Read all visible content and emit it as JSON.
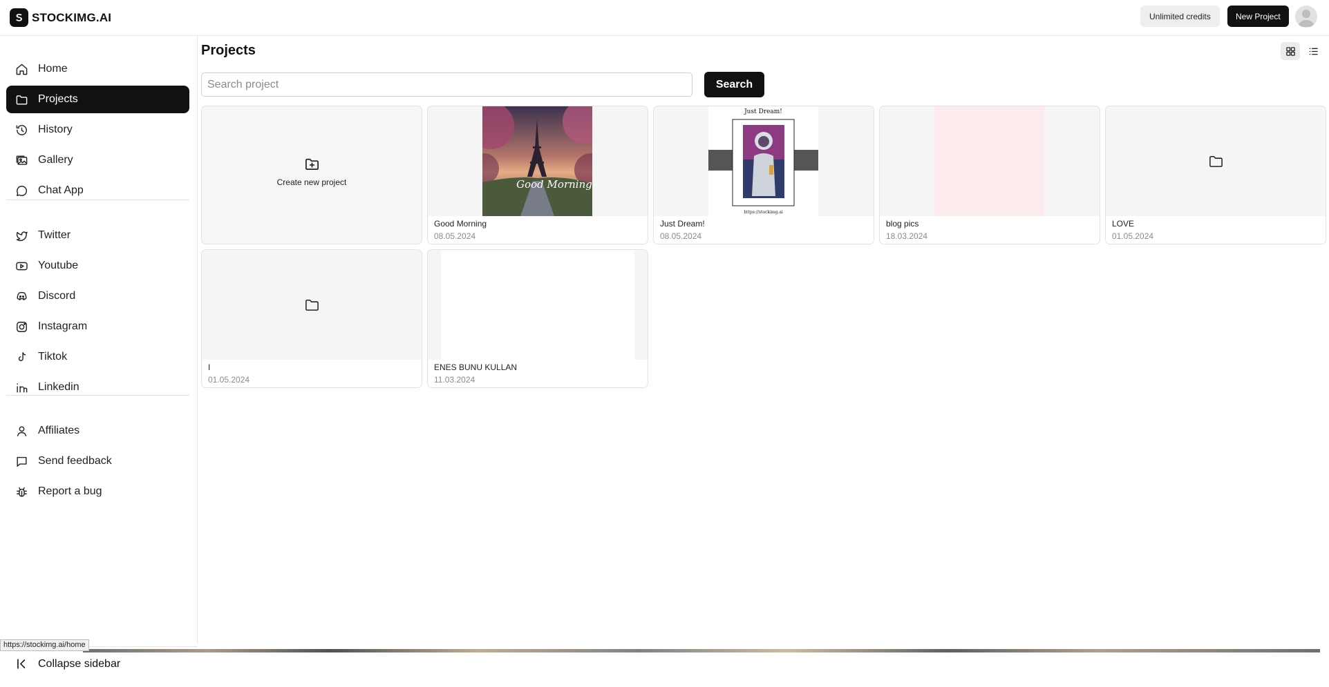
{
  "header": {
    "logo_text": "STOCKIMG.AI",
    "credits_label": "Unlimited credits",
    "new_project_label": "New Project"
  },
  "sidebar": {
    "primary": [
      {
        "label": "Home",
        "icon": "home-icon"
      },
      {
        "label": "Projects",
        "icon": "folder-icon",
        "active": true
      },
      {
        "label": "History",
        "icon": "history-icon"
      },
      {
        "label": "Gallery",
        "icon": "gallery-icon"
      },
      {
        "label": "Chat App",
        "icon": "chat-icon"
      }
    ],
    "social": [
      {
        "label": "Twitter",
        "icon": "twitter-icon"
      },
      {
        "label": "Youtube",
        "icon": "youtube-icon"
      },
      {
        "label": "Discord",
        "icon": "discord-icon"
      },
      {
        "label": "Instagram",
        "icon": "instagram-icon"
      },
      {
        "label": "Tiktok",
        "icon": "tiktok-icon"
      },
      {
        "label": "Linkedin",
        "icon": "linkedin-icon"
      }
    ],
    "secondary": [
      {
        "label": "Affiliates",
        "icon": "user-icon"
      },
      {
        "label": "Send feedback",
        "icon": "feedback-icon"
      },
      {
        "label": "Report a bug",
        "icon": "bug-icon"
      }
    ],
    "collapse_label": "Collapse sidebar"
  },
  "main": {
    "title": "Projects",
    "search_placeholder": "Search project",
    "search_button": "Search",
    "create_label": "Create new project",
    "projects": [
      {
        "name": "Good Morning",
        "date": "08.05.2024",
        "thumb": "eiffel-tower-image"
      },
      {
        "name": "Just Dream!",
        "date": "08.05.2024",
        "thumb": "astronaut-poster-image"
      },
      {
        "name": "blog pics",
        "date": "18.03.2024",
        "thumb": "pink-placeholder"
      },
      {
        "name": "LOVE",
        "date": "01.05.2024",
        "thumb": "folder-icon"
      },
      {
        "name": "I",
        "date": "01.05.2024",
        "thumb": "folder-icon"
      },
      {
        "name": "ENES BUNU KULLAN",
        "date": "11.03.2024",
        "thumb": "white-placeholder"
      }
    ],
    "thumb_text": {
      "good_morning": "Good Morning",
      "just_dream_title": "Just Dream!",
      "just_dream_url": "https://stockimg.ai"
    }
  },
  "status_bar": {
    "url": "https://stockimg.ai/home"
  },
  "colors": {
    "accent": "#111111",
    "border": "#e2e2e2",
    "blog_thumb": "#fdeced"
  }
}
